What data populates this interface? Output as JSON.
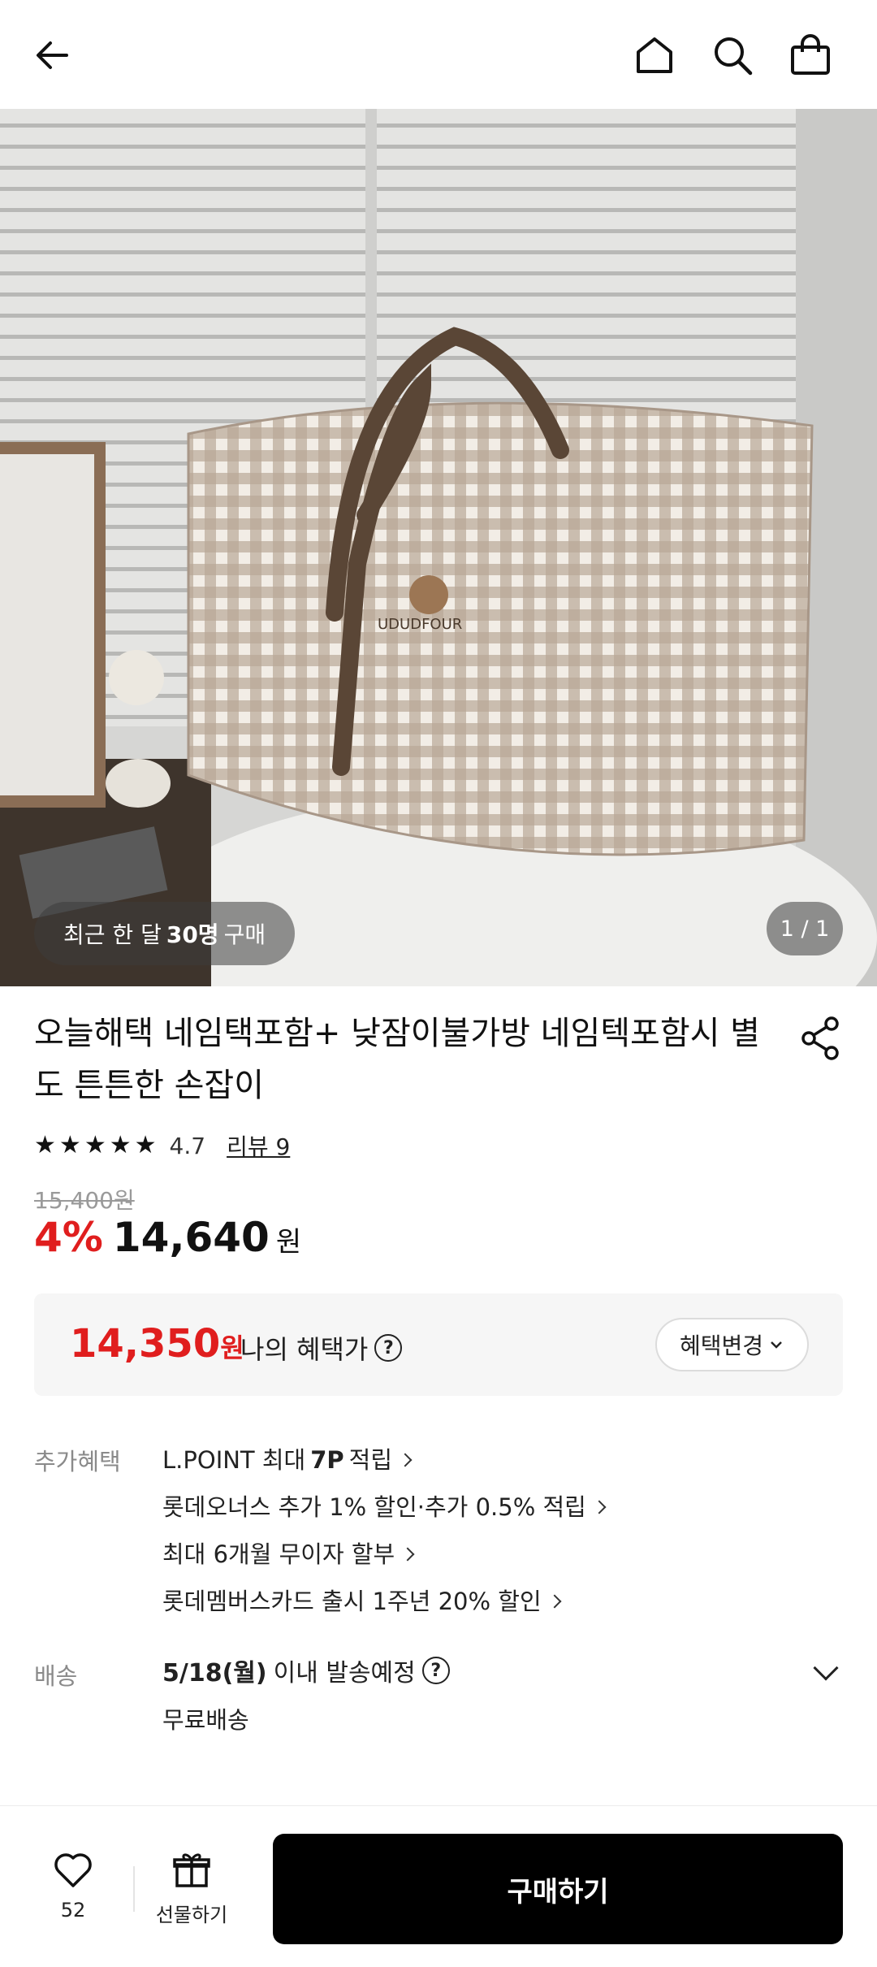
{
  "header": {
    "back_icon": "arrow-left-icon",
    "home_icon": "home-icon",
    "search_icon": "search-icon",
    "cart_icon": "shopping-bag-icon"
  },
  "hero": {
    "badge_prefix": "최근 한 달",
    "badge_count": "30명",
    "badge_suffix": "구매",
    "counter": "1 / 1"
  },
  "product": {
    "title": "오늘해택 네임택포함+ 낮잠이불가방 네임텍포함시 별도 튼튼한 손잡이",
    "rating_value": "4.7",
    "review_link": "리뷰 9",
    "original_price": "15,400원",
    "discount": "4%",
    "price": "14,640",
    "price_unit": "원"
  },
  "benefit": {
    "my_price": "14,350",
    "my_price_unit": "원",
    "label": "나의 혜택가",
    "change_button": "혜택변경"
  },
  "extra": {
    "label": "추가혜택",
    "items": [
      {
        "pre": "L.POINT 최대",
        "bold": "7P",
        "post": "적립"
      },
      {
        "pre": "롯데오너스 추가 1% 할인·추가 0.5% 적립",
        "bold": "",
        "post": ""
      },
      {
        "pre": "최대 6개월 무이자 할부",
        "bold": "",
        "post": ""
      },
      {
        "pre": "롯데멤버스카드 출시 1주년 20% 할인",
        "bold": "",
        "post": ""
      }
    ]
  },
  "shipping": {
    "label": "배송",
    "date": "5/18(월)",
    "date_suffix": "이내 발송예정",
    "free": "무료배송"
  },
  "bottom": {
    "wish_count": "52",
    "gift_label": "선물하기",
    "buy_label": "구매하기"
  },
  "colors": {
    "discount_red": "#e01e1e",
    "buy_button": "#000000"
  }
}
